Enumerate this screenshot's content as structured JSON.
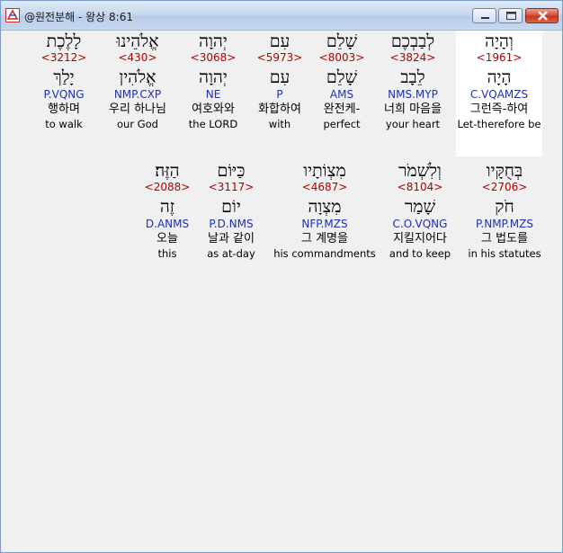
{
  "window": {
    "title": "@원전분해 - 왕상 8:61",
    "controls": [
      "minimize",
      "maximize",
      "close"
    ],
    "icon": "app-logo-icon"
  },
  "row1": [
    {
      "heb": "וְהָיָה",
      "num": "<1961>",
      "lemma": "הָיָה",
      "parse": "C.VQAMZS",
      "kor": "그런즉-하여",
      "eng": "Let-therefore be",
      "highlight": true
    },
    {
      "heb": "לְבַבְכֶם",
      "num": "<3824>",
      "lemma": "לֵבָב",
      "parse": "NMS.MYP",
      "kor": "너희 마음을",
      "eng": "your heart",
      "highlight": false
    },
    {
      "heb": "שָׁלֵם",
      "num": "<8003>",
      "lemma": "שָׁלֵם",
      "parse": "AMS",
      "kor": "완전케-",
      "eng": "perfect",
      "highlight": false
    },
    {
      "heb": "עִם",
      "num": "<5973>",
      "lemma": "עִם",
      "parse": "P",
      "kor": "화합하여",
      "eng": "with",
      "highlight": false
    },
    {
      "heb": "יְהוָה",
      "num": "<3068>",
      "lemma": "יְהוָה",
      "parse": "NE",
      "kor": "여호와와",
      "eng": "the LORD",
      "highlight": false
    },
    {
      "heb": "אֱלֹהֵינוּ",
      "num": "<430>",
      "lemma": "אֱלֹהִין",
      "parse": "NMP.CXP",
      "kor": "우리 하나님",
      "eng": "our God",
      "highlight": false
    },
    {
      "heb": "לָלֶכֶת",
      "num": "<3212>",
      "lemma": "יָלַךְ",
      "parse": "P.VQNG",
      "kor": "행하며",
      "eng": "to walk",
      "highlight": false
    }
  ],
  "row2": [
    {
      "heb": "בְּחֻקָּיו",
      "num": "<2706>",
      "lemma": "חֹק",
      "parse": "P.NMP.MZS",
      "kor": "그 법도를",
      "eng": "in his statutes"
    },
    {
      "heb": "וְלִשְׁמֹר",
      "num": "<8104>",
      "lemma": "שָׁמַר",
      "parse": "C.O.VQNG",
      "kor": "지킬지어다",
      "eng": "and to keep"
    },
    {
      "heb": "מִצְוֹתָיו",
      "num": "<4687>",
      "lemma": "מִצְוָה",
      "parse": "NFP.MZS",
      "kor": "그 계명을",
      "eng": "his commandments"
    },
    {
      "heb": "כַּיּוֹם",
      "num": "<3117>",
      "lemma": "יוֹם",
      "parse": "P.D.NMS",
      "kor": "날과 같이",
      "eng": "as at-day"
    },
    {
      "heb": "הַזֶּה׃",
      "num": "<2088>",
      "lemma": "זֶה",
      "parse": "D.ANMS",
      "kor": "오늘",
      "eng": "this"
    }
  ]
}
